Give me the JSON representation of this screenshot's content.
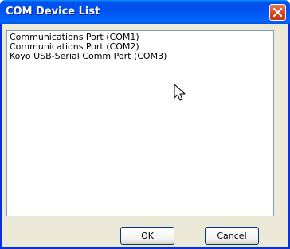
{
  "window": {
    "title": "COM Device List"
  },
  "list": {
    "items": [
      "Communications Port (COM1)",
      "Communications Port (COM2)",
      "Koyo USB-Serial Comm Port (COM3)"
    ]
  },
  "buttons": {
    "ok_label": "OK",
    "cancel_label": "Cancel"
  },
  "icons": {
    "close": "close-icon",
    "cursor": "mouse-pointer-icon"
  },
  "colors": {
    "title_bar": "#0054e3",
    "close_button": "#d4461f",
    "dialog_background": "#ece9d8",
    "list_border": "#7f9db9"
  }
}
